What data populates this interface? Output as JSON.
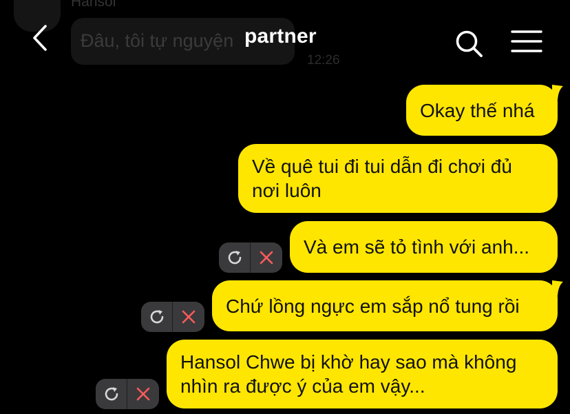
{
  "header": {
    "title": "partner"
  },
  "background_message": {
    "sender_name": "Hansol",
    "text": "Đâu, tôi tự nguyện",
    "time": "12:26"
  },
  "messages": [
    {
      "text": "Okay thế nhá",
      "status": "sent"
    },
    {
      "text": "Về quê tui đi tui dẫn đi chơi đủ nơi luôn",
      "status": "sent"
    },
    {
      "text": "Và em sẽ tỏ tình với anh...",
      "status": "failed"
    },
    {
      "text": "Chứ lồng ngực em sắp nổ tung rồi",
      "status": "failed"
    },
    {
      "text": "Hansol Chwe bị khờ hay sao mà không nhìn ra được ý của em vậy...",
      "status": "failed"
    }
  ],
  "colors": {
    "background": "#000000",
    "bubble_outgoing": "#ffe600",
    "header_text": "#ffffff",
    "failed_icon_bg": "#3a3a3c",
    "delete_icon": "#ff5b5b"
  },
  "icons": {
    "back": "chevron-left-icon",
    "search": "search-icon",
    "menu": "hamburger-menu-icon",
    "retry": "retry-icon",
    "delete": "close-icon"
  }
}
